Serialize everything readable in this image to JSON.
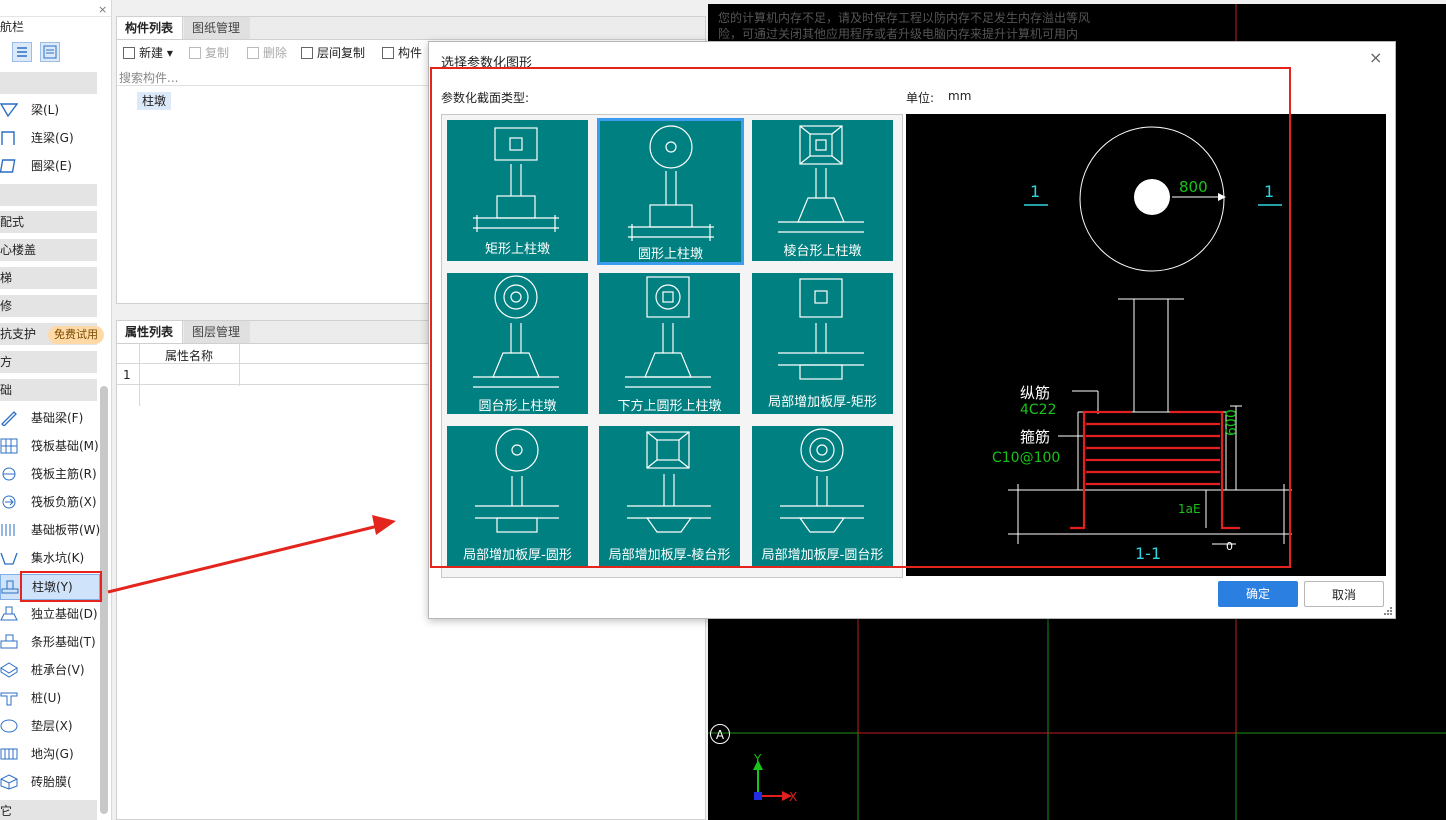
{
  "nav": {
    "title": "导航栏",
    "close": "×",
    "groups": [
      "配式",
      "心楼盖",
      "梯",
      "修",
      "抗支护",
      "方",
      "础",
      "它"
    ],
    "badge": "免费试用",
    "items": [
      {
        "label": "梁(L)",
        "icon": "beam-icon"
      },
      {
        "label": "连梁(G)",
        "icon": "coupling-beam-icon"
      },
      {
        "label": "圈梁(E)",
        "icon": "ring-beam-icon"
      },
      {
        "label": "基础梁(F)",
        "icon": "foundation-beam-icon"
      },
      {
        "label": "筏板基础(M)",
        "icon": "raft-foundation-icon"
      },
      {
        "label": "筏板主筋(R)",
        "icon": "raft-main-rebar-icon"
      },
      {
        "label": "筏板负筋(X)",
        "icon": "raft-negative-rebar-icon"
      },
      {
        "label": "基础板带(W)",
        "icon": "foundation-strip-icon"
      },
      {
        "label": "集水坑(K)",
        "icon": "sump-pit-icon"
      },
      {
        "label": "柱墩(Y)",
        "icon": "column-pier-icon"
      },
      {
        "label": "独立基础(D)",
        "icon": "isolated-footing-icon"
      },
      {
        "label": "条形基础(T)",
        "icon": "strip-footing-icon"
      },
      {
        "label": "桩承台(V)",
        "icon": "pile-cap-icon"
      },
      {
        "label": "桩(U)",
        "icon": "pile-icon"
      },
      {
        "label": "垫层(X)",
        "icon": "cushion-icon"
      },
      {
        "label": "地沟(G)",
        "icon": "trench-icon"
      },
      {
        "label": "砖胎膜(",
        "icon": "brick-mold-icon"
      }
    ]
  },
  "component_panel": {
    "tabs": [
      "构件列表",
      "图纸管理"
    ],
    "toolbar": [
      "新建",
      "复制",
      "删除",
      "层间复制",
      "构件"
    ],
    "search_placeholder": "搜索构件...",
    "chip": "柱墩"
  },
  "property_panel": {
    "tabs": [
      "属性列表",
      "图层管理"
    ],
    "column": "属性名称",
    "row_number": "1"
  },
  "canvas": {
    "warning_lines": [
      "您的计算机内存不足，请及时保存工程以防内存不足发生内存溢出等风",
      "险，可通过关闭其他应用程序或者升级电脑内存来提升计算机可用内"
    ],
    "axis_label": "A",
    "x_label": "X",
    "y_label": "Y"
  },
  "dialog": {
    "title": "选择参数化图形",
    "close": "×",
    "type_label": "参数化截面类型:",
    "unit_label": "单位:",
    "unit_value": "mm",
    "shapes": [
      "矩形上柱墩",
      "圆形上柱墩",
      "棱台形上柱墩",
      "圆台形上柱墩",
      "下方上圆形上柱墩",
      "局部增加板厚-矩形",
      "局部增加板厚-圆形",
      "局部增加板厚-棱台形",
      "局部增加板厚-圆台形"
    ],
    "selected_shape": "圆形上柱墩",
    "preview": {
      "section_mark": "1",
      "diameter": "800",
      "height": "600",
      "long_rebar_label": "纵筋",
      "long_rebar_value": "4C22",
      "stirrup_label": "箍筋",
      "stirrup_value": "C10@100",
      "anchor_label": "1aE",
      "zero_label": "0",
      "section_title": "1-1"
    },
    "ok": "确定",
    "cancel": "取消"
  }
}
